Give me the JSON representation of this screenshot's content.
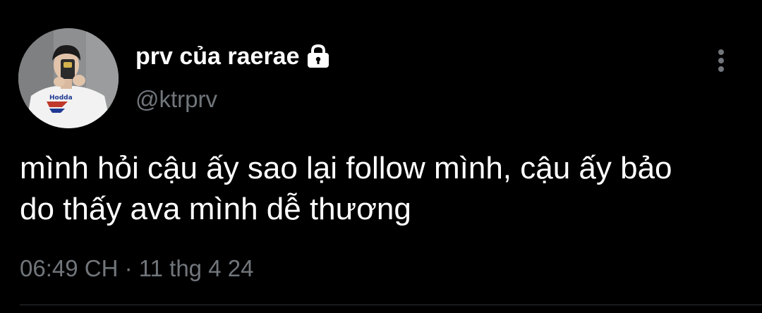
{
  "tweet": {
    "author": {
      "display_name": "prv của raerae",
      "handle": "@ktrprv",
      "protected_icon": "lock-icon",
      "avatar": "avatar-photo"
    },
    "menu_icon": "more-vertical-icon",
    "text": "mình hỏi cậu ấy sao lại follow mình, cậu ấy bảo\ndo thấy ava mình dễ thương",
    "timestamp": "06:49 CH · 11 thg 4 24"
  },
  "colors": {
    "background": "#000000",
    "primary_text": "#ffffff",
    "secondary_text": "#71767b",
    "divider": "#2f3336"
  }
}
